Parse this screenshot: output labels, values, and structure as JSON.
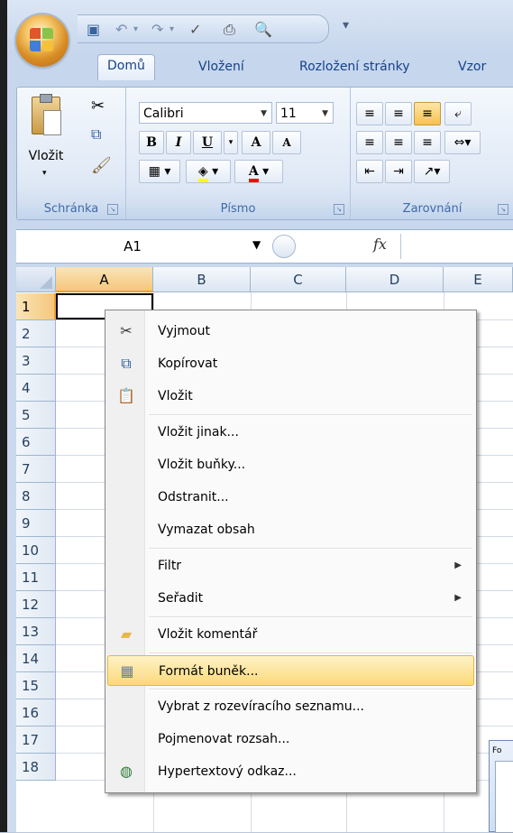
{
  "app": {
    "colors": {
      "ribbon_text": "#15428b",
      "selected_header": "#f5c77c",
      "menu_highlight": "#fcd97a"
    }
  },
  "tabs": [
    {
      "label": "Domů",
      "active": true
    },
    {
      "label": "Vložení"
    },
    {
      "label": "Rozložení stránky"
    },
    {
      "label": "Vzor"
    }
  ],
  "ribbon": {
    "clipboard": {
      "paste_label": "Vložit",
      "group_label": "Schránka"
    },
    "font": {
      "font_name": "Calibri",
      "font_size": "11",
      "bold": "B",
      "italic": "I",
      "underline": "U",
      "grow": "A",
      "shrink": "A",
      "color": "A",
      "group_label": "Písmo"
    },
    "alignment": {
      "group_label": "Zarovnání"
    }
  },
  "formula_bar": {
    "name_box": "A1",
    "fx": "fx",
    "value": ""
  },
  "grid": {
    "columns": [
      "A",
      "B",
      "C",
      "D",
      "E"
    ],
    "rows": [
      "1",
      "2",
      "3",
      "4",
      "5",
      "6",
      "7",
      "8",
      "9",
      "10",
      "11",
      "12",
      "13",
      "14",
      "15",
      "16",
      "17",
      "18"
    ],
    "active_cell": "A1"
  },
  "context_menu": {
    "items": [
      {
        "label": "Vyjmout",
        "icon": "scissors-icon"
      },
      {
        "label": "Kopírovat",
        "icon": "copy-icon"
      },
      {
        "label": "Vložit",
        "icon": "paste-icon"
      },
      {
        "label": "Vložit jinak..."
      },
      {
        "label": "Vložit buňky..."
      },
      {
        "label": "Odstranit..."
      },
      {
        "label": "Vymazat obsah"
      },
      {
        "label": "Filtr",
        "submenu": true
      },
      {
        "label": "Seřadit",
        "submenu": true
      },
      {
        "label": "Vložit komentář",
        "icon": "comment-icon"
      },
      {
        "label": "Formát buněk...",
        "icon": "format-cells-icon",
        "highlighted": true
      },
      {
        "label": "Vybrat z rozevíracího seznamu..."
      },
      {
        "label": "Pojmenovat rozsah..."
      },
      {
        "label": "Hypertextový odkaz...",
        "icon": "hyperlink-icon"
      }
    ]
  },
  "dialog_fragment": {
    "title": "Fo"
  }
}
